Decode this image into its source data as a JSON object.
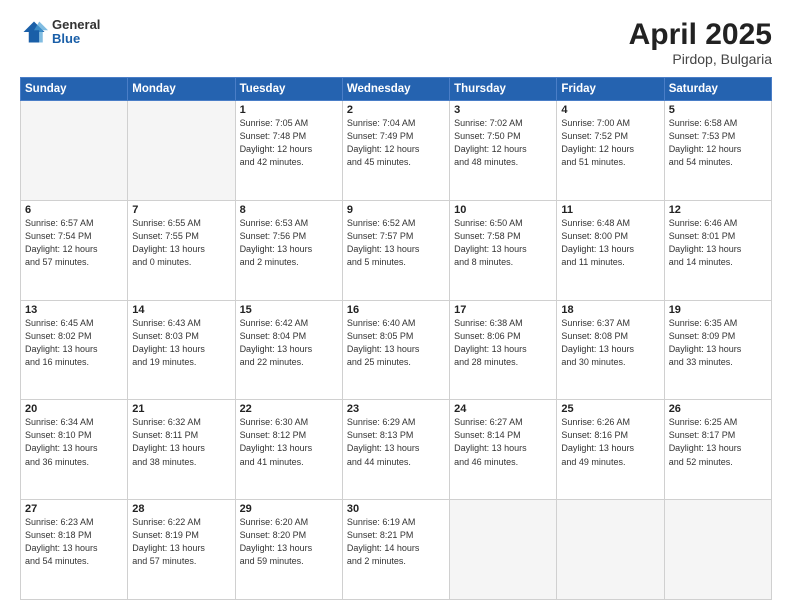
{
  "header": {
    "logo_general": "General",
    "logo_blue": "Blue",
    "month_title": "April 2025",
    "location": "Pirdop, Bulgaria"
  },
  "days_of_week": [
    "Sunday",
    "Monday",
    "Tuesday",
    "Wednesday",
    "Thursday",
    "Friday",
    "Saturday"
  ],
  "weeks": [
    {
      "shaded": false,
      "days": [
        {
          "num": "",
          "info": ""
        },
        {
          "num": "",
          "info": ""
        },
        {
          "num": "1",
          "info": "Sunrise: 7:05 AM\nSunset: 7:48 PM\nDaylight: 12 hours\nand 42 minutes."
        },
        {
          "num": "2",
          "info": "Sunrise: 7:04 AM\nSunset: 7:49 PM\nDaylight: 12 hours\nand 45 minutes."
        },
        {
          "num": "3",
          "info": "Sunrise: 7:02 AM\nSunset: 7:50 PM\nDaylight: 12 hours\nand 48 minutes."
        },
        {
          "num": "4",
          "info": "Sunrise: 7:00 AM\nSunset: 7:52 PM\nDaylight: 12 hours\nand 51 minutes."
        },
        {
          "num": "5",
          "info": "Sunrise: 6:58 AM\nSunset: 7:53 PM\nDaylight: 12 hours\nand 54 minutes."
        }
      ]
    },
    {
      "shaded": true,
      "days": [
        {
          "num": "6",
          "info": "Sunrise: 6:57 AM\nSunset: 7:54 PM\nDaylight: 12 hours\nand 57 minutes."
        },
        {
          "num": "7",
          "info": "Sunrise: 6:55 AM\nSunset: 7:55 PM\nDaylight: 13 hours\nand 0 minutes."
        },
        {
          "num": "8",
          "info": "Sunrise: 6:53 AM\nSunset: 7:56 PM\nDaylight: 13 hours\nand 2 minutes."
        },
        {
          "num": "9",
          "info": "Sunrise: 6:52 AM\nSunset: 7:57 PM\nDaylight: 13 hours\nand 5 minutes."
        },
        {
          "num": "10",
          "info": "Sunrise: 6:50 AM\nSunset: 7:58 PM\nDaylight: 13 hours\nand 8 minutes."
        },
        {
          "num": "11",
          "info": "Sunrise: 6:48 AM\nSunset: 8:00 PM\nDaylight: 13 hours\nand 11 minutes."
        },
        {
          "num": "12",
          "info": "Sunrise: 6:46 AM\nSunset: 8:01 PM\nDaylight: 13 hours\nand 14 minutes."
        }
      ]
    },
    {
      "shaded": false,
      "days": [
        {
          "num": "13",
          "info": "Sunrise: 6:45 AM\nSunset: 8:02 PM\nDaylight: 13 hours\nand 16 minutes."
        },
        {
          "num": "14",
          "info": "Sunrise: 6:43 AM\nSunset: 8:03 PM\nDaylight: 13 hours\nand 19 minutes."
        },
        {
          "num": "15",
          "info": "Sunrise: 6:42 AM\nSunset: 8:04 PM\nDaylight: 13 hours\nand 22 minutes."
        },
        {
          "num": "16",
          "info": "Sunrise: 6:40 AM\nSunset: 8:05 PM\nDaylight: 13 hours\nand 25 minutes."
        },
        {
          "num": "17",
          "info": "Sunrise: 6:38 AM\nSunset: 8:06 PM\nDaylight: 13 hours\nand 28 minutes."
        },
        {
          "num": "18",
          "info": "Sunrise: 6:37 AM\nSunset: 8:08 PM\nDaylight: 13 hours\nand 30 minutes."
        },
        {
          "num": "19",
          "info": "Sunrise: 6:35 AM\nSunset: 8:09 PM\nDaylight: 13 hours\nand 33 minutes."
        }
      ]
    },
    {
      "shaded": true,
      "days": [
        {
          "num": "20",
          "info": "Sunrise: 6:34 AM\nSunset: 8:10 PM\nDaylight: 13 hours\nand 36 minutes."
        },
        {
          "num": "21",
          "info": "Sunrise: 6:32 AM\nSunset: 8:11 PM\nDaylight: 13 hours\nand 38 minutes."
        },
        {
          "num": "22",
          "info": "Sunrise: 6:30 AM\nSunset: 8:12 PM\nDaylight: 13 hours\nand 41 minutes."
        },
        {
          "num": "23",
          "info": "Sunrise: 6:29 AM\nSunset: 8:13 PM\nDaylight: 13 hours\nand 44 minutes."
        },
        {
          "num": "24",
          "info": "Sunrise: 6:27 AM\nSunset: 8:14 PM\nDaylight: 13 hours\nand 46 minutes."
        },
        {
          "num": "25",
          "info": "Sunrise: 6:26 AM\nSunset: 8:16 PM\nDaylight: 13 hours\nand 49 minutes."
        },
        {
          "num": "26",
          "info": "Sunrise: 6:25 AM\nSunset: 8:17 PM\nDaylight: 13 hours\nand 52 minutes."
        }
      ]
    },
    {
      "shaded": false,
      "days": [
        {
          "num": "27",
          "info": "Sunrise: 6:23 AM\nSunset: 8:18 PM\nDaylight: 13 hours\nand 54 minutes."
        },
        {
          "num": "28",
          "info": "Sunrise: 6:22 AM\nSunset: 8:19 PM\nDaylight: 13 hours\nand 57 minutes."
        },
        {
          "num": "29",
          "info": "Sunrise: 6:20 AM\nSunset: 8:20 PM\nDaylight: 13 hours\nand 59 minutes."
        },
        {
          "num": "30",
          "info": "Sunrise: 6:19 AM\nSunset: 8:21 PM\nDaylight: 14 hours\nand 2 minutes."
        },
        {
          "num": "",
          "info": ""
        },
        {
          "num": "",
          "info": ""
        },
        {
          "num": "",
          "info": ""
        }
      ]
    }
  ]
}
